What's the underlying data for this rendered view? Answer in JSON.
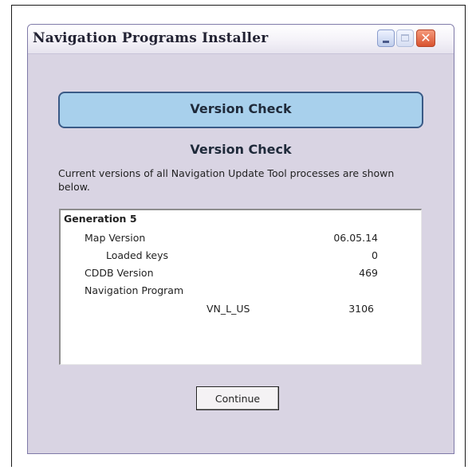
{
  "window": {
    "title": "Navigation Programs Installer",
    "buttons": {
      "minimize_icon": "minimize-icon",
      "maximize_icon": "maximize-icon",
      "close_icon": "close-icon",
      "close_glyph": "✕"
    }
  },
  "header": {
    "banner_title": "Version Check"
  },
  "content": {
    "section_title": "Version Check",
    "description": "Current versions of all Navigation Update Tool processes are shown below."
  },
  "versions": {
    "group_label": "Generation 5",
    "rows": [
      {
        "label": "Map Version",
        "value": "06.05.14"
      },
      {
        "label": "Loaded keys",
        "value": "0"
      },
      {
        "label": "CDDB Version",
        "value": "469"
      },
      {
        "label": "Navigation Program",
        "value": ""
      }
    ],
    "program": {
      "name": "VN_L_US",
      "value": "3106"
    }
  },
  "actions": {
    "continue_label": "Continue"
  },
  "colors": {
    "banner_fill": "#a8d0ec",
    "banner_border": "#3a5a86",
    "window_bg": "#d9d4e3",
    "close_button": "#d9532f"
  }
}
